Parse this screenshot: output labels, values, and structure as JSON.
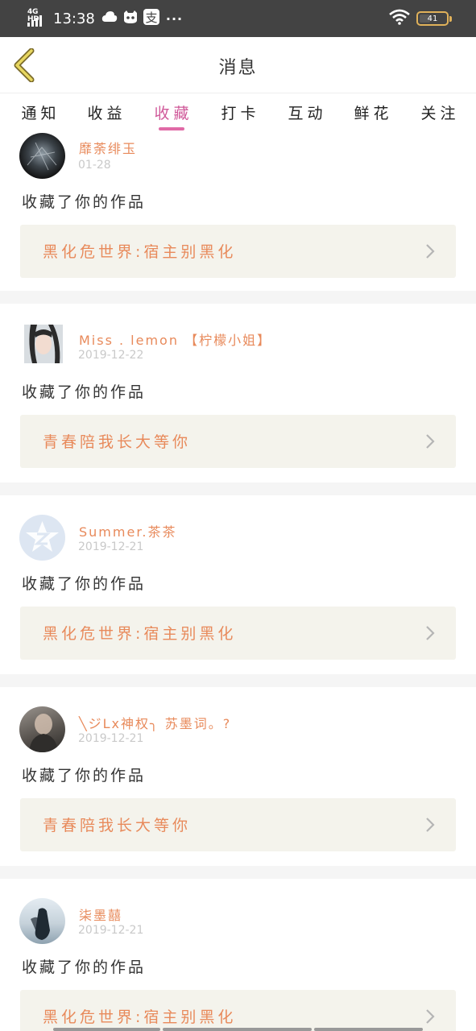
{
  "status_bar": {
    "network": "4G HD",
    "time": "13:38",
    "icons": [
      "cloud-icon",
      "cat-app-icon",
      "alipay-icon"
    ],
    "more": "···",
    "wifi": "wifi-icon",
    "battery_level": "41"
  },
  "header": {
    "title": "消息",
    "back_icon": "chevron-left-icon"
  },
  "tabs": [
    {
      "label": "通知"
    },
    {
      "label": "收益"
    },
    {
      "label": "收藏"
    },
    {
      "label": "打卡"
    },
    {
      "label": "互动"
    },
    {
      "label": "鲜花"
    },
    {
      "label": "关注"
    }
  ],
  "active_tab": "收藏",
  "messages": [
    {
      "user": "靡荼绯玉",
      "date": "01-28",
      "action": "收藏了你的作品",
      "work_title": "黑化危世界:宿主别黑化"
    },
    {
      "user": "Miss . lemon 【柠檬小姐】",
      "date": "2019-12-22",
      "action": "收藏了你的作品",
      "work_title": "青春陪我长大等你"
    },
    {
      "user": "Summer.茶茶",
      "date": "2019-12-21",
      "action": "收藏了你的作品",
      "work_title": "黑化危世界:宿主别黑化"
    },
    {
      "user": "╲ジLx神权╮ 苏墨词。?",
      "date": "2019-12-21",
      "action": "收藏了你的作品",
      "work_title": "青春陪我长大等你"
    },
    {
      "user": "柒墨囍",
      "date": "2019-12-21",
      "action": "收藏了你的作品",
      "work_title": "黑化危世界:宿主别黑化"
    }
  ],
  "colors": {
    "accent_pink": "#d05a9a",
    "username_orange": "#e88a5b",
    "work_card_bg": "#f4f3ec",
    "status_bar_bg": "#434343"
  }
}
